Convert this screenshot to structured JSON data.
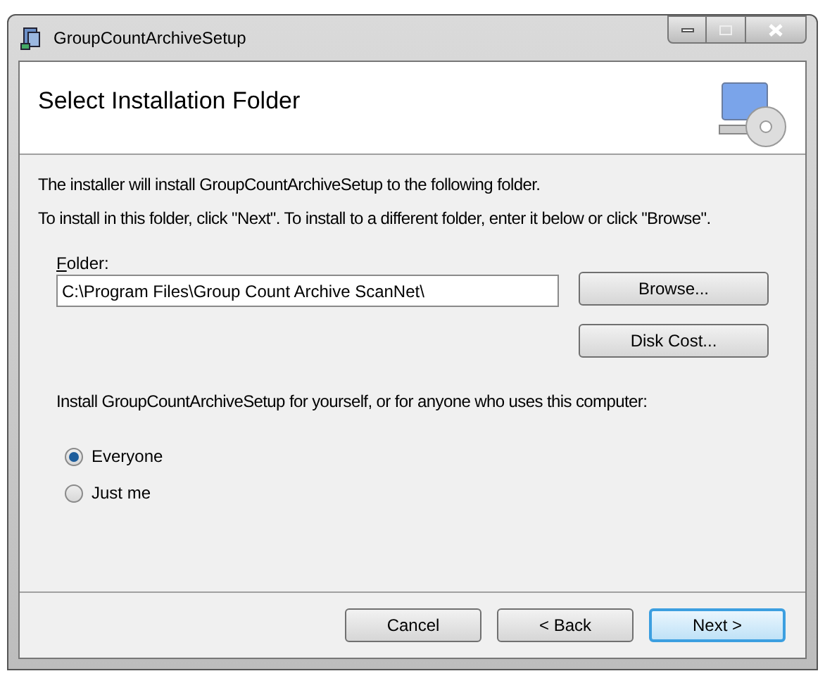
{
  "window": {
    "title": "GroupCountArchiveSetup"
  },
  "header": {
    "title": "Select Installation Folder"
  },
  "intro": [
    "The installer will install GroupCountArchiveSetup to the following folder.",
    "To install in this folder, click \"Next\". To install to a different folder, enter it below or click \"Browse\"."
  ],
  "folder": {
    "label": "Folder:",
    "value": "C:\\Program Files\\Group Count Archive ScanNet\\"
  },
  "side_buttons": [
    "Browse...",
    "Disk Cost..."
  ],
  "scope": {
    "prompt": "Install GroupCountArchiveSetup for yourself, or for anyone who uses this computer:",
    "options": [
      {
        "label": "Everyone",
        "selected": true
      },
      {
        "label": "Just me",
        "selected": false
      }
    ]
  },
  "buttons": [
    {
      "label": "Cancel",
      "default": false
    },
    {
      "label": "< Back",
      "default": false
    },
    {
      "label": "Next >",
      "default": true
    }
  ]
}
